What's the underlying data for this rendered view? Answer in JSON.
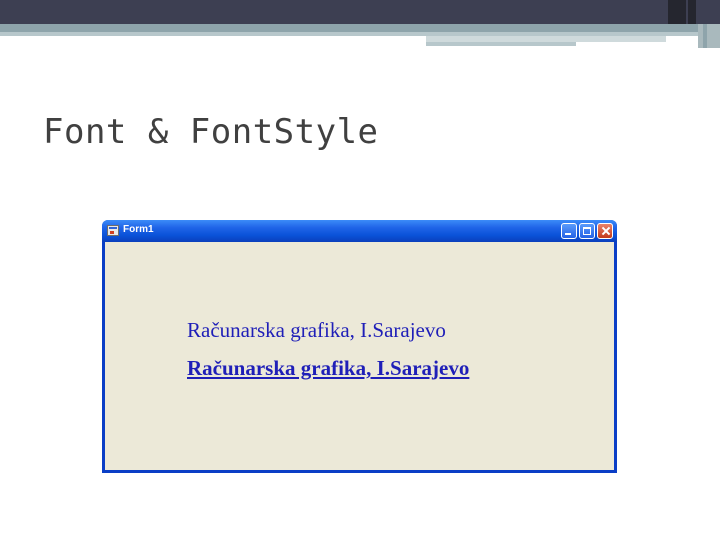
{
  "slide": {
    "title": "Font & FontStyle"
  },
  "window": {
    "title": "Form1",
    "icons": {
      "app": "app-icon",
      "minimize": "minimize-icon",
      "maximize": "maximize-icon",
      "close": "close-icon"
    }
  },
  "form": {
    "text_regular": "Računarska grafika, I.Sarajevo",
    "text_bold_underline": "Računarska grafika, I.Sarajevo"
  },
  "colors": {
    "text": "#1f1fb8",
    "form_background": "#ece9d8",
    "title_bar": "#0a52d8"
  }
}
